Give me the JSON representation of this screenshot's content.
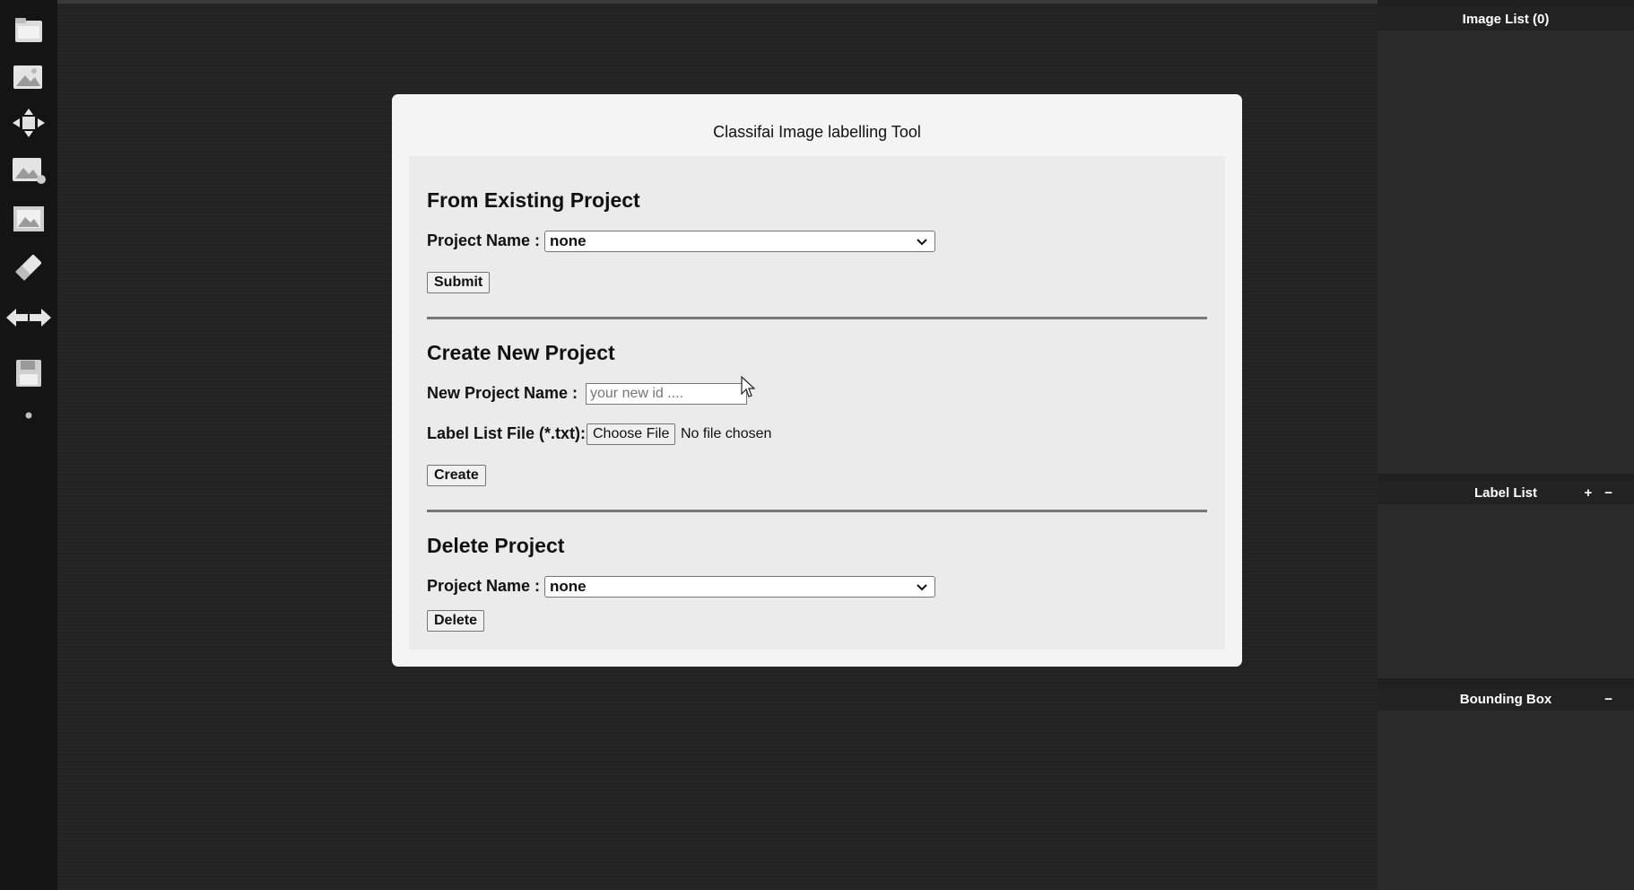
{
  "right_panels": {
    "image_list": {
      "title": "Image List (0)"
    },
    "label_list": {
      "title": "Label List",
      "add": "+",
      "remove": "−"
    },
    "bounding_box": {
      "title": "Bounding Box",
      "remove": "−"
    }
  },
  "modal": {
    "title": "Classifai Image labelling Tool",
    "existing": {
      "heading": "From Existing Project",
      "project_label": "Project Name :",
      "project_value": "none",
      "submit": "Submit"
    },
    "create": {
      "heading": "Create New Project",
      "name_label": "New Project Name :",
      "name_placeholder": "your new id ....",
      "file_label": "Label List File (*.txt):",
      "choose_file": "Choose File",
      "file_status": "No file chosen",
      "create": "Create"
    },
    "delete": {
      "heading": "Delete Project",
      "project_label": "Project Name :",
      "project_value": "none",
      "delete": "Delete"
    }
  },
  "icons": [
    "folder-icon",
    "image-import-icon",
    "move-icon",
    "image-icon",
    "image-frame-icon",
    "eraser-icon",
    "arrow-left-icon",
    "arrow-right-icon",
    "save-icon",
    "dot-icon"
  ]
}
